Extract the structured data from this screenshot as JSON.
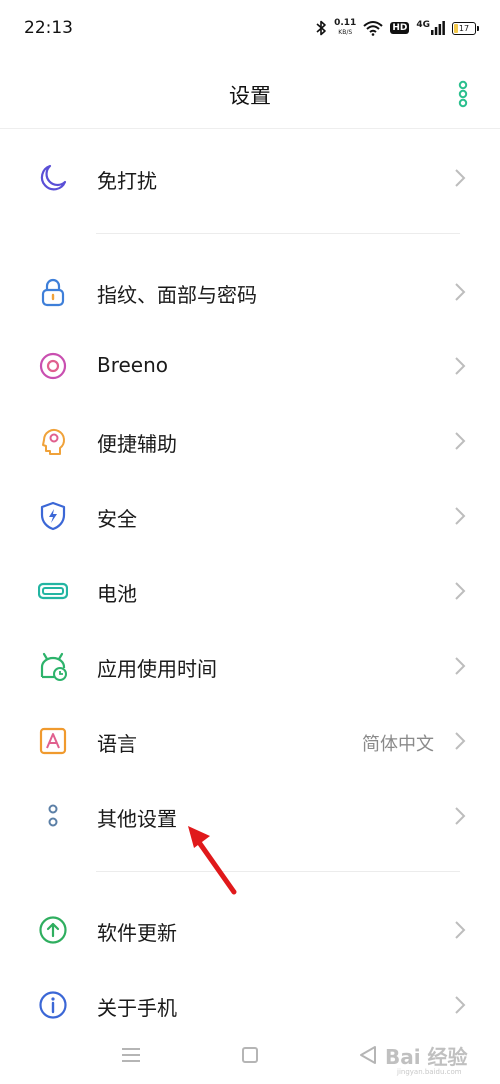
{
  "status_bar": {
    "time": "22:13",
    "net_speed_value": "0.11",
    "net_speed_unit": "KB/S",
    "hd_label": "HD",
    "network_type": "4G",
    "battery_level": "17",
    "icons": [
      "bluetooth-icon",
      "wifi-icon",
      "signal-icon",
      "battery-icon"
    ]
  },
  "header": {
    "title": "设置",
    "more_icon": "more-vertical-icon",
    "accent_color": "#2bbf8e"
  },
  "settings_items": [
    {
      "label": "免打扰",
      "icon": "moon-icon",
      "color": "#5a4fd6"
    },
    {
      "label": "指纹、面部与密码",
      "icon": "lock-icon",
      "color": "#3e7fd9"
    },
    {
      "label": "Breeno",
      "icon": "breeno-icon",
      "color": "#c94fb0"
    },
    {
      "label": "便捷辅助",
      "icon": "assist-icon",
      "color": "#f0a23a"
    },
    {
      "label": "安全",
      "icon": "shield-icon",
      "color": "#3b67d6"
    },
    {
      "label": "电池",
      "icon": "battery-icon",
      "color": "#23b5a2"
    },
    {
      "label": "应用使用时间",
      "icon": "app-time-icon",
      "color": "#2db36b"
    },
    {
      "label": "语言",
      "icon": "language-icon",
      "color": "#f09a2e",
      "value": "简体中文"
    },
    {
      "label": "其他设置",
      "icon": "other-settings-icon",
      "color": "#5b7fa6"
    },
    {
      "label": "软件更新",
      "icon": "update-icon",
      "color": "#2fae5f"
    },
    {
      "label": "关于手机",
      "icon": "info-icon",
      "color": "#3b67d6"
    }
  ],
  "nav_bar": {
    "icons": [
      "menu-icon",
      "home-icon",
      "back-icon"
    ]
  },
  "watermark": {
    "text": "Bai 经验",
    "sub": "jingyan.baidu.com"
  }
}
